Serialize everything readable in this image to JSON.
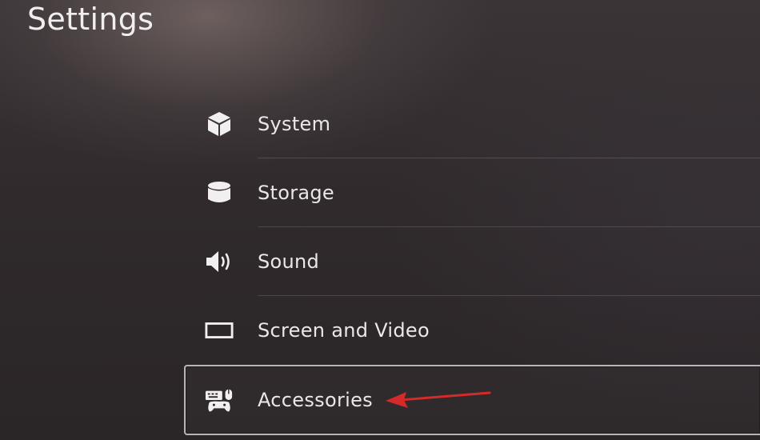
{
  "header": {
    "title": "Settings"
  },
  "menu": {
    "items": [
      {
        "label": "System",
        "icon": "cube-icon"
      },
      {
        "label": "Storage",
        "icon": "storage-icon"
      },
      {
        "label": "Sound",
        "icon": "speaker-icon"
      },
      {
        "label": "Screen and Video",
        "icon": "screen-icon"
      },
      {
        "label": "Accessories",
        "icon": "accessories-icon",
        "selected": true
      }
    ]
  },
  "colors": {
    "text": "#ebe7e8",
    "selection_border": "#b9b4b7",
    "annotation_arrow": "#d42a2a"
  }
}
